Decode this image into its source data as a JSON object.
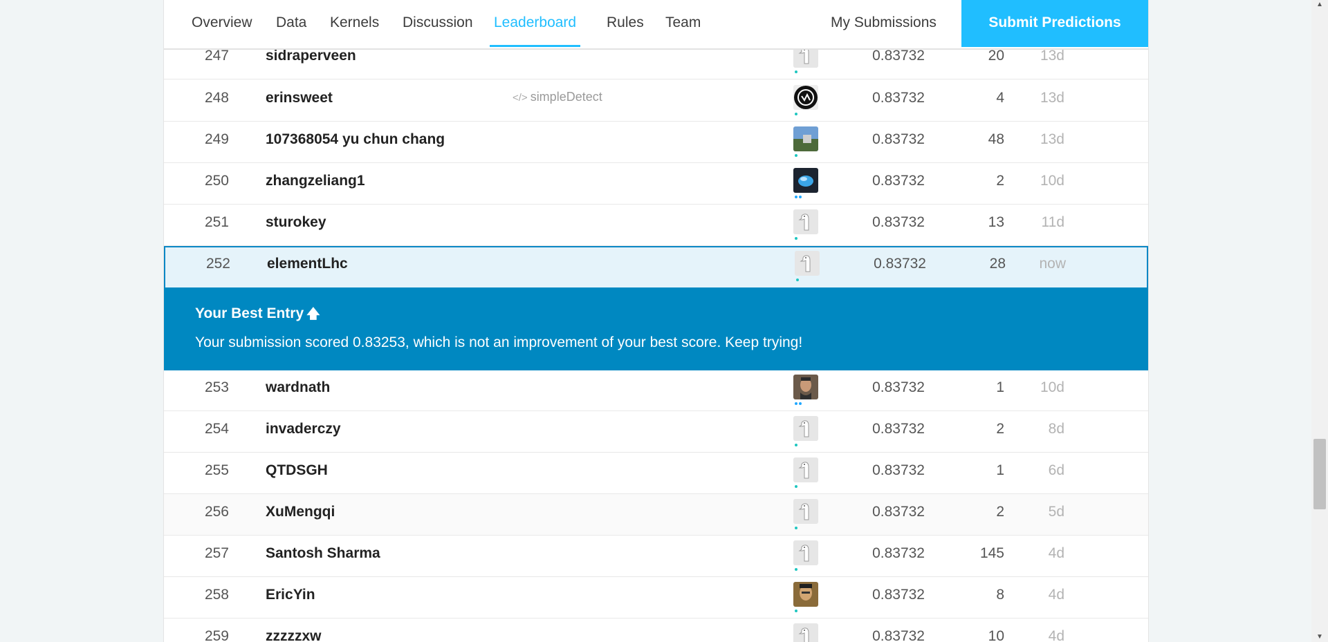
{
  "nav": {
    "tabs": [
      {
        "label": "Overview"
      },
      {
        "label": "Data"
      },
      {
        "label": "Kernels"
      },
      {
        "label": "Discussion"
      },
      {
        "label": "Leaderboard"
      },
      {
        "label": "Rules"
      },
      {
        "label": "Team"
      }
    ],
    "active_tab": "Leaderboard",
    "my_submissions": "My Submissions",
    "submit_label": "Submit Predictions"
  },
  "rows": [
    {
      "rank": "247",
      "team": "sidraperveen",
      "kernel": "",
      "score": "0.83732",
      "entries": "20",
      "last": "13d",
      "avatar": "default"
    },
    {
      "rank": "248",
      "team": "erinsweet",
      "kernel": "simpleDetect",
      "score": "0.83732",
      "entries": "4",
      "last": "13d",
      "avatar": "logo"
    },
    {
      "rank": "249",
      "team": "107368054 yu chun chang",
      "kernel": "",
      "score": "0.83732",
      "entries": "48",
      "last": "13d",
      "avatar": "photo"
    },
    {
      "rank": "250",
      "team": "zhangzeliang1",
      "kernel": "",
      "score": "0.83732",
      "entries": "2",
      "last": "10d",
      "avatar": "dark"
    },
    {
      "rank": "251",
      "team": "sturokey",
      "kernel": "",
      "score": "0.83732",
      "entries": "13",
      "last": "11d",
      "avatar": "default"
    },
    {
      "rank": "252",
      "team": "elementLhc",
      "kernel": "",
      "score": "0.83732",
      "entries": "28",
      "last": "now",
      "avatar": "default"
    },
    {
      "rank": "253",
      "team": "wardnath",
      "kernel": "",
      "score": "0.83732",
      "entries": "1",
      "last": "10d",
      "avatar": "face"
    },
    {
      "rank": "254",
      "team": "invaderczy",
      "kernel": "",
      "score": "0.83732",
      "entries": "2",
      "last": "8d",
      "avatar": "default"
    },
    {
      "rank": "255",
      "team": "QTDSGH",
      "kernel": "",
      "score": "0.83732",
      "entries": "1",
      "last": "6d",
      "avatar": "default"
    },
    {
      "rank": "256",
      "team": "XuMengqi",
      "kernel": "",
      "score": "0.83732",
      "entries": "2",
      "last": "5d",
      "avatar": "default"
    },
    {
      "rank": "257",
      "team": "Santosh Sharma",
      "kernel": "",
      "score": "0.83732",
      "entries": "145",
      "last": "4d",
      "avatar": "default"
    },
    {
      "rank": "258",
      "team": "EricYin",
      "kernel": "",
      "score": "0.83732",
      "entries": "8",
      "last": "4d",
      "avatar": "face2"
    },
    {
      "rank": "259",
      "team": "zzzzzxw",
      "kernel": "",
      "score": "0.83732",
      "entries": "10",
      "last": "4d",
      "avatar": "default"
    }
  ],
  "banner": {
    "title": "Your Best Entry",
    "message": "Your submission scored 0.83253, which is not an improvement of your best score. Keep trying!"
  },
  "colors": {
    "accent": "#20beff",
    "banner": "#0088c1",
    "highlight_row": "#e5f3fa",
    "tier_dot": "#1ec6c0"
  }
}
